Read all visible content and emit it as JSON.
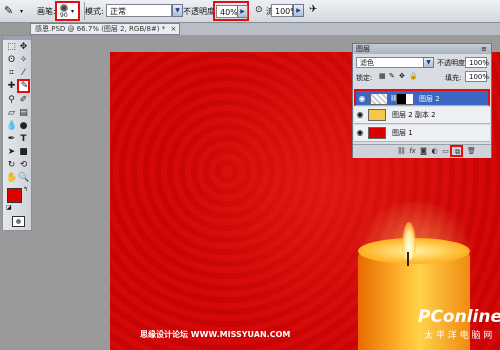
{
  "options_bar": {
    "brush_label": "画笔:",
    "brush_size": "90",
    "mode_label": "模式:",
    "mode_value": "正常",
    "opacity_label": "不透明度:",
    "opacity_value": "40%",
    "flow_label": "流量:",
    "flow_value": "100%"
  },
  "document_tab": {
    "title": "感恩.PSD @ 66.7% (图层 2, RGB/8#) *",
    "close": "×"
  },
  "layers_panel": {
    "title": "图层",
    "blend_mode": "滤色",
    "opacity_label": "不透明度:",
    "opacity_value": "100%",
    "lock_label": "锁定:",
    "fill_label": "填充:",
    "fill_value": "100%",
    "layers": [
      {
        "name": "图层 2"
      },
      {
        "name": "图层 2 副本 2"
      },
      {
        "name": "图层 1"
      }
    ]
  },
  "watermark": {
    "left_text": "思缘设计论坛  WWW.MISSYUAN.COM",
    "logo_text": "PConline",
    "logo_sub": "太 平 洋 电 脑 网"
  },
  "colors": {
    "foreground": "#e00000",
    "background": "#000000",
    "highlight": "#e01010",
    "selected_layer": "#3a66c4"
  }
}
